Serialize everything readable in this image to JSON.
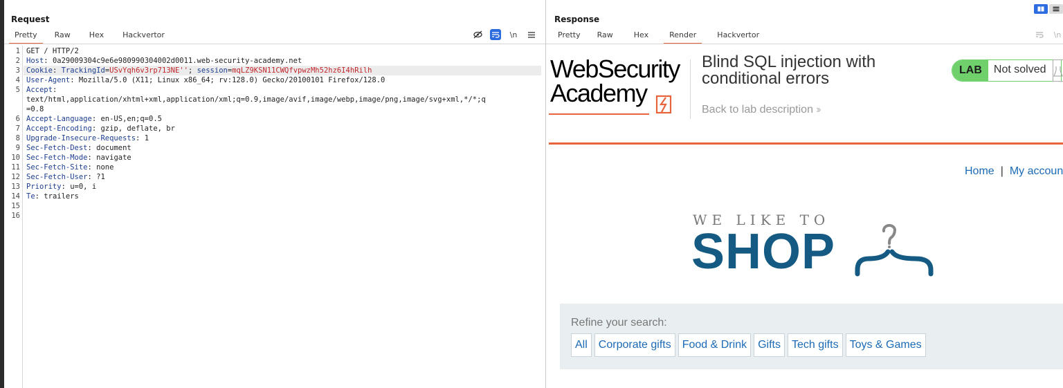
{
  "request": {
    "title": "Request",
    "tabs": [
      "Pretty",
      "Raw",
      "Hex",
      "Hackvertor"
    ],
    "active_tab": "Pretty",
    "newline_label": "\\n",
    "lines": [
      {
        "num": "1",
        "parts": [
          {
            "t": "GET / HTTP/2",
            "c": "plain"
          }
        ]
      },
      {
        "num": "2",
        "parts": [
          {
            "t": "Host",
            "c": "hname"
          },
          {
            "t": ": 0a29009304c9e6e980990304002d0011.web-security-academy.net",
            "c": "plain"
          }
        ]
      },
      {
        "num": "3",
        "parts": [
          {
            "t": "Cookie",
            "c": "hname"
          },
          {
            "t": ": ",
            "c": "plain"
          },
          {
            "t": "TrackingId",
            "c": "hname"
          },
          {
            "t": "=",
            "c": "plain"
          },
          {
            "t": "USvYqh6v3rp713NE''",
            "c": "cval"
          },
          {
            "t": "; ",
            "c": "plain"
          },
          {
            "t": "session",
            "c": "hname"
          },
          {
            "t": "=",
            "c": "plain"
          },
          {
            "t": "mqLZ9KSN11CWQfvpwzMh52hz6I4hRilh",
            "c": "cval"
          }
        ]
      },
      {
        "num": "4",
        "parts": [
          {
            "t": "User-Agent",
            "c": "hname"
          },
          {
            "t": ": Mozilla/5.0 (X11; Linux x86_64; rv:128.0) Gecko/20100101 Firefox/128.0",
            "c": "plain"
          }
        ]
      },
      {
        "num": "5",
        "parts": [
          {
            "t": "Accept",
            "c": "hname"
          },
          {
            "t": ":",
            "c": "plain"
          }
        ]
      },
      {
        "num": "",
        "parts": [
          {
            "t": "text/html,application/xhtml+xml,application/xml;q=0.9,image/avif,image/webp,image/png,image/svg+xml,*/*;q",
            "c": "plain"
          }
        ]
      },
      {
        "num": "",
        "parts": [
          {
            "t": "=0.8",
            "c": "plain"
          }
        ]
      },
      {
        "num": "6",
        "parts": [
          {
            "t": "Accept-Language",
            "c": "hname"
          },
          {
            "t": ": en-US,en;q=0.5",
            "c": "plain"
          }
        ]
      },
      {
        "num": "7",
        "parts": [
          {
            "t": "Accept-Encoding",
            "c": "hname"
          },
          {
            "t": ": gzip, deflate, br",
            "c": "plain"
          }
        ]
      },
      {
        "num": "8",
        "parts": [
          {
            "t": "Upgrade-Insecure-Requests",
            "c": "hname"
          },
          {
            "t": ": 1",
            "c": "plain"
          }
        ]
      },
      {
        "num": "9",
        "parts": [
          {
            "t": "Sec-Fetch-Dest",
            "c": "hname"
          },
          {
            "t": ": document",
            "c": "plain"
          }
        ]
      },
      {
        "num": "10",
        "parts": [
          {
            "t": "Sec-Fetch-Mode",
            "c": "hname"
          },
          {
            "t": ": navigate",
            "c": "plain"
          }
        ]
      },
      {
        "num": "11",
        "parts": [
          {
            "t": "Sec-Fetch-Site",
            "c": "hname"
          },
          {
            "t": ": none",
            "c": "plain"
          }
        ]
      },
      {
        "num": "12",
        "parts": [
          {
            "t": "Sec-Fetch-User",
            "c": "hname"
          },
          {
            "t": ": ?1",
            "c": "plain"
          }
        ]
      },
      {
        "num": "13",
        "parts": [
          {
            "t": "Priority",
            "c": "hname"
          },
          {
            "t": ": u=0, i",
            "c": "plain"
          }
        ]
      },
      {
        "num": "14",
        "parts": [
          {
            "t": "Te",
            "c": "hname"
          },
          {
            "t": ": trailers",
            "c": "plain"
          }
        ]
      },
      {
        "num": "15",
        "parts": []
      },
      {
        "num": "16",
        "parts": []
      }
    ],
    "highlighted_line": "3"
  },
  "response": {
    "title": "Response",
    "tabs": [
      "Pretty",
      "Raw",
      "Hex",
      "Render",
      "Hackvertor"
    ],
    "active_tab": "Render",
    "newline_label": "\\n",
    "page": {
      "logo_line1": "WebSecurity",
      "logo_line2": "Academy",
      "lab_title": "Blind SQL injection with conditional errors",
      "back_link": "Back to lab description",
      "lab_badge": "LAB",
      "lab_status": "Not solved",
      "nav_home": "Home",
      "nav_separator": "|",
      "nav_account": "My account",
      "hero_small": "WE LIKE TO",
      "hero_big": "SHOP",
      "refine_label": "Refine your search:",
      "categories": [
        "All",
        "Corporate gifts",
        "Food & Drink",
        "Gifts",
        "Tech gifts",
        "Toys & Games"
      ]
    }
  },
  "colors": {
    "accent_orange": "#e8643c",
    "burp_blue": "#2d6cdf",
    "header_name": "#1c3d8f",
    "cookie_value": "#c0262b",
    "lab_green": "#70d16c",
    "link_blue": "#1b6ab5",
    "shop_blue": "#155a82"
  },
  "icons": {
    "request_toolbar": [
      "eye-slash-icon",
      "wrap-lines-icon",
      "newline-icon",
      "menu-icon"
    ],
    "response_toolbar": [
      "wrap-lines-icon",
      "newline-icon"
    ],
    "layout": [
      "split-horizontal-icon",
      "split-vertical-icon"
    ]
  }
}
